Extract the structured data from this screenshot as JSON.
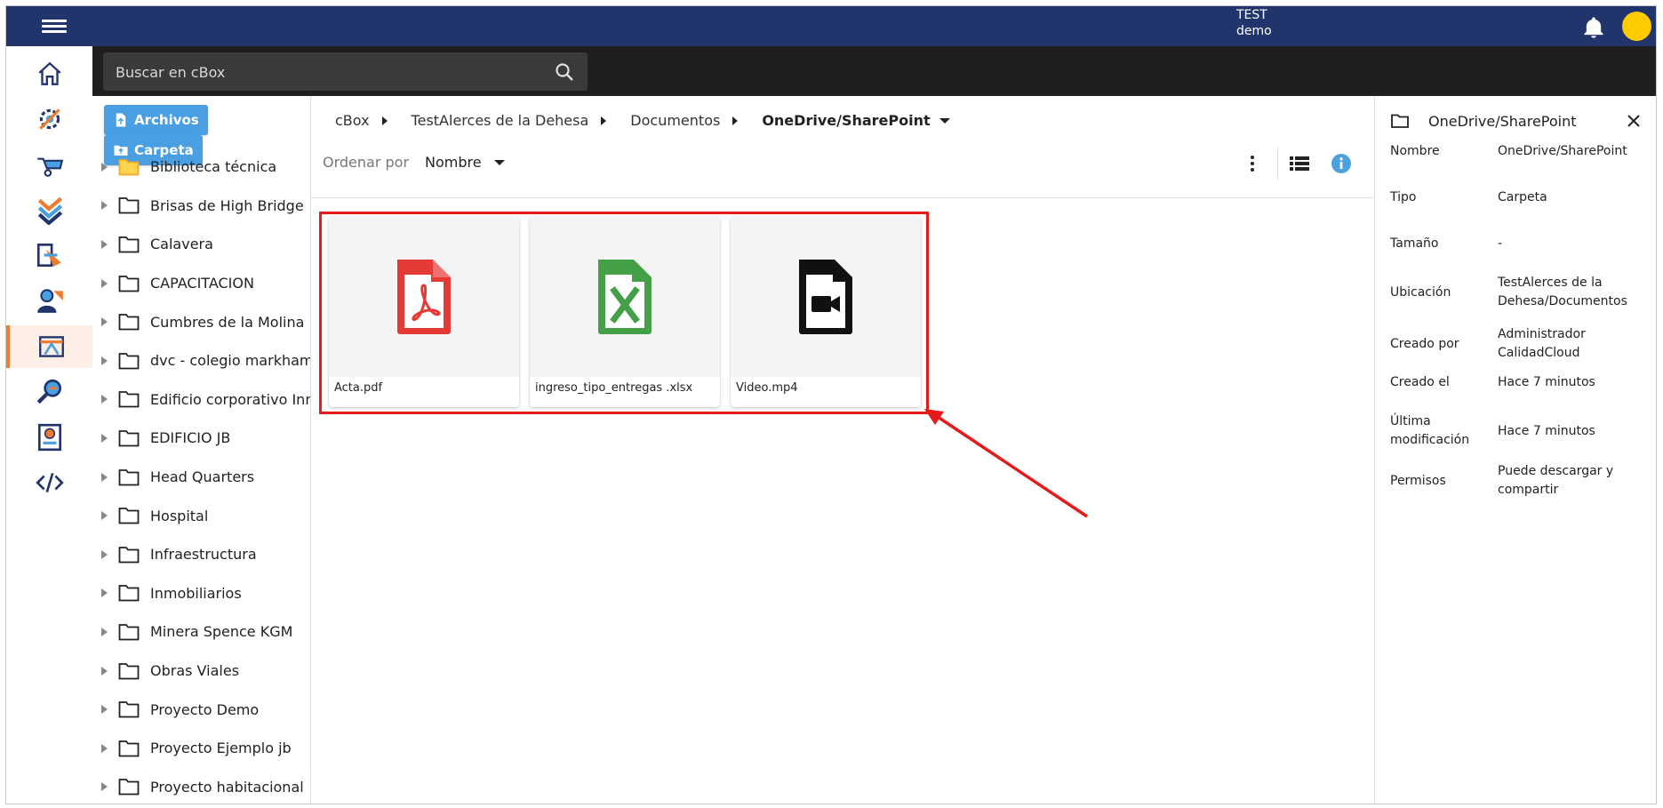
{
  "topbar": {
    "user_line1": "TEST",
    "user_line2": "demo",
    "avatar_color": "#ffcc00",
    "bar_color": "#22346c"
  },
  "rail": {
    "items": [
      {
        "name": "home-icon"
      },
      {
        "name": "settings-tools-icon"
      },
      {
        "name": "wheelbarrow-icon"
      },
      {
        "name": "checklist-icon"
      },
      {
        "name": "login-icon"
      },
      {
        "name": "users-icon"
      },
      {
        "name": "document-storage-icon",
        "active": true
      },
      {
        "name": "search-analysis-icon"
      },
      {
        "name": "certificate-icon"
      },
      {
        "name": "code-icon"
      }
    ]
  },
  "search": {
    "placeholder": "Buscar en cBox"
  },
  "tree": {
    "upload_files_label": "Archivos",
    "upload_folder_label": "Carpeta",
    "items": [
      "Biblioteca técnica",
      "Brisas de High Bridge",
      "Calavera",
      "CAPACITACION",
      "Cumbres de la Molina",
      "dvc - colegio markham",
      "Edificio corporativo Inn",
      "EDIFICIO JB",
      "Head Quarters",
      "Hospital",
      "Infraestructura",
      "Inmobiliarios",
      "Minera Spence KGM",
      "Obras Viales",
      "Proyecto Demo",
      "Proyecto Ejemplo jb",
      "Proyecto habitacional"
    ]
  },
  "main": {
    "breadcrumb": [
      "cBox",
      "TestAlerces de la Dehesa",
      "Documentos",
      "OneDrive/SharePoint"
    ],
    "sort_label": "Ordenar por",
    "sort_value": "Nombre",
    "files": [
      {
        "name": "Acta.pdf",
        "icon": "pdf-file-icon",
        "color": "#e53935"
      },
      {
        "name": "ingreso_tipo_entregas .xlsx",
        "icon": "excel-file-icon",
        "color": "#43a047"
      },
      {
        "name": "Video.mp4",
        "icon": "video-file-icon",
        "color": "#111111"
      }
    ],
    "highlight_color": "#e31b1b"
  },
  "details": {
    "title": "OneDrive/SharePoint",
    "rows": [
      {
        "key": "Nombre",
        "value": "OneDrive/SharePoint"
      },
      {
        "key": "Tipo",
        "value": "Carpeta"
      },
      {
        "key": "Tamaño",
        "value": "-"
      },
      {
        "key": "Ubicación",
        "value": "TestAlerces de la Dehesa/Documentos"
      },
      {
        "key": "Creado por",
        "value": "Administrador CalidadCloud"
      },
      {
        "key": "Creado el",
        "value": "Hace 7 minutos"
      },
      {
        "key": "Última modificación",
        "value": "Hace 7 minutos"
      },
      {
        "key": "Permisos",
        "value": "Puede descargar y compartir"
      }
    ]
  }
}
